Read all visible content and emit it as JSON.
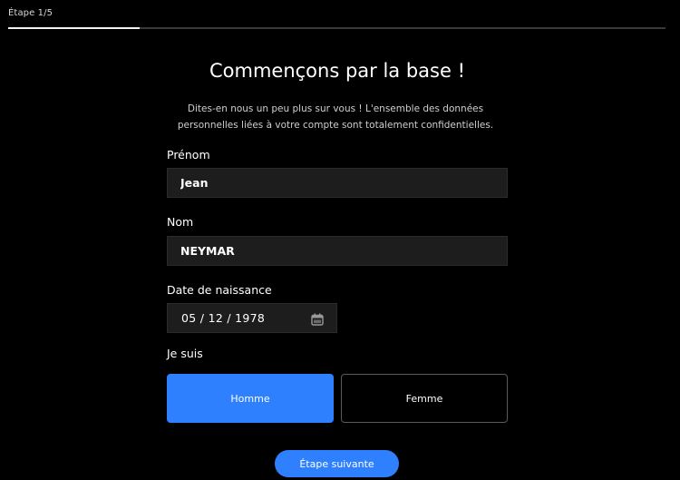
{
  "progress": {
    "step_label": "Étape 1/5",
    "fraction": 0.2
  },
  "header": {
    "title": "Commençons par la base !",
    "subtitle_line1": "Dites-en nous un peu plus sur vous ! L'ensemble des données",
    "subtitle_line2": "personnelles liées à votre compte sont totalement confidentielles."
  },
  "form": {
    "first_name": {
      "label": "Prénom",
      "value": "Jean"
    },
    "last_name": {
      "label": "Nom",
      "value": "NEYMAR"
    },
    "birth_date": {
      "label": "Date de naissance",
      "value": "05 / 12 / 1978",
      "icon": "calendar-icon"
    },
    "gender": {
      "label": "Je suis",
      "options": [
        "Homme",
        "Femme"
      ],
      "selected": "Homme"
    }
  },
  "actions": {
    "next_label": "Étape suivante"
  },
  "colors": {
    "accent": "#2f80ff",
    "background": "#000000",
    "field_bg": "#1d1d1d"
  }
}
